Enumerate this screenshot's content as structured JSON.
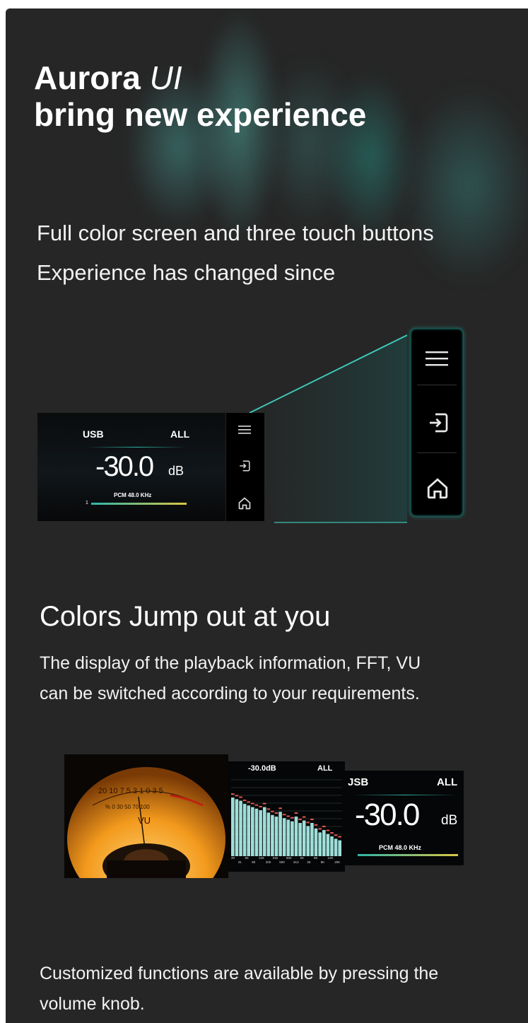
{
  "header": {
    "brand": "Aurora",
    "brand_suffix": "UI",
    "headline": "bring new experience"
  },
  "intro": {
    "line1": "Full color screen and three touch buttons",
    "line2": "Experience has changed since"
  },
  "screen_small": {
    "source": "USB",
    "mode": "ALL",
    "volume": "-30.0",
    "volume_unit": "dB",
    "format": "PCM 48.0 KHz",
    "bar_index": "1",
    "buttons": [
      "menu-icon",
      "input-icon",
      "home-icon"
    ]
  },
  "side_panel": {
    "buttons": [
      "menu-icon",
      "input-icon",
      "home-icon"
    ]
  },
  "section2": {
    "heading": "Colors Jump out at you",
    "line1": "The display of the playback information, FFT, VU",
    "line2": "can be switched according to your requirements."
  },
  "vu_meter": {
    "scale_top": "20 10 7 5 3 1 0  3 5",
    "scale_bottom": "% 0 30 50 70 100",
    "label": "VU"
  },
  "fft_screen": {
    "volume": "-30.0dB",
    "mode": "ALL",
    "band_levels": [
      0.74,
      0.72,
      0.7,
      0.66,
      0.64,
      0.62,
      0.6,
      0.58,
      0.62,
      0.55,
      0.52,
      0.5,
      0.56,
      0.48,
      0.46,
      0.44,
      0.5,
      0.42,
      0.45,
      0.38,
      0.42,
      0.35,
      0.3,
      0.33,
      0.28,
      0.25,
      0.22,
      0.2
    ],
    "freq_labels": [
      "20",
      "31",
      "50",
      "80",
      "125",
      "200",
      "315",
      "500",
      "800",
      "1K2",
      "2K",
      "3K",
      "5K",
      "8K",
      "12K",
      "20K"
    ]
  },
  "screen_large": {
    "source": "JSB",
    "mode": "ALL",
    "volume": "-30.0",
    "volume_unit": "dB",
    "format": "PCM 48.0 KHz"
  },
  "section3": {
    "line1": "Customized functions are available by pressing the",
    "line2": "volume knob."
  },
  "colors": {
    "background": "#262626",
    "accent": "#2fb5a8",
    "meter_amber": "#f39a1d"
  }
}
